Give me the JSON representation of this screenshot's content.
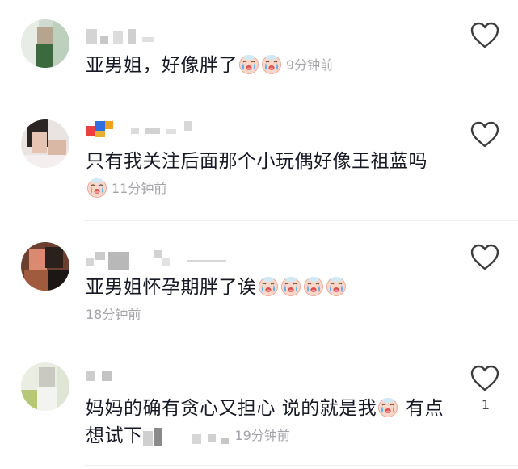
{
  "comments": [
    {
      "text": "亚男姐，好像胖了",
      "time": "9分钟前",
      "emoji_count": 2,
      "likes": ""
    },
    {
      "text": "只有我关注后面那个小玩偶好像王祖蓝吗",
      "time": "11分钟前",
      "emoji_count": 1,
      "likes": ""
    },
    {
      "text": "亚男姐怀孕期胖了诶",
      "time": "18分钟前",
      "emoji_count": 4,
      "likes": ""
    },
    {
      "text_part1": "妈妈的确有贪心又担心 说的就是我",
      "text_part2": "有点想试下",
      "time": "19分钟前",
      "emoji_count": 1,
      "likes": "1"
    }
  ],
  "icons": {
    "like": "heart-outline-icon",
    "emoji": "crying-face-emoji"
  },
  "colors": {
    "text": "#161823",
    "meta": "#a3a3a8",
    "heart": "#3c3c3c"
  }
}
